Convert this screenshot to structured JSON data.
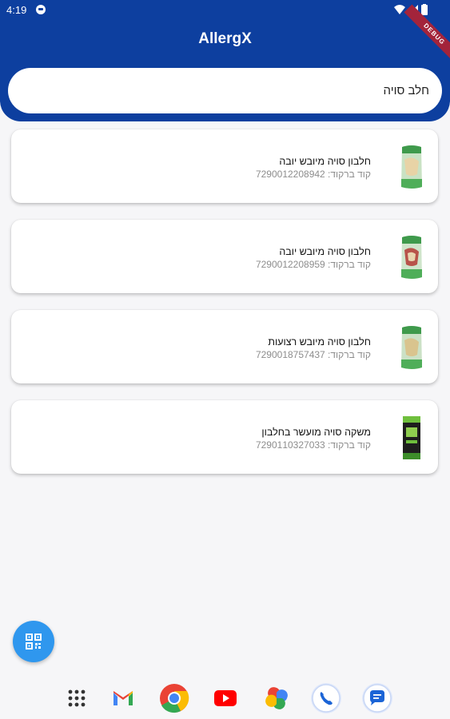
{
  "status_bar": {
    "time": "4:19",
    "debug_label": "DEBUG"
  },
  "app": {
    "title": "AllergX",
    "header_color": "#0d3f9f"
  },
  "search": {
    "value": "חלב סויה",
    "placeholder": ""
  },
  "products": [
    {
      "name": "חלבון סויה מיובש יובה",
      "barcode_label": "קוד ברקוד: 7290012208942",
      "thumb_icon": "green-pouch-icon"
    },
    {
      "name": "חלבון סויה מיובש יובה",
      "barcode_label": "קוד ברקוד: 7290012208959",
      "thumb_icon": "green-red-pouch-icon"
    },
    {
      "name": "חלבון סויה מיובש רצועות",
      "barcode_label": "קוד ברקוד: 7290018757437",
      "thumb_icon": "green-pouch-icon"
    },
    {
      "name": "משקה סויה מועשר בחלבון",
      "barcode_label": "קוד ברקוד: 7290110327033",
      "thumb_icon": "black-carton-icon"
    }
  ],
  "fab": {
    "icon": "qr-scan-icon",
    "color": "#2f97ee"
  },
  "dock": [
    "app-drawer-icon",
    "gmail-icon",
    "chrome-icon",
    "youtube-icon",
    "photos-icon",
    "phone-icon",
    "messages-icon"
  ]
}
